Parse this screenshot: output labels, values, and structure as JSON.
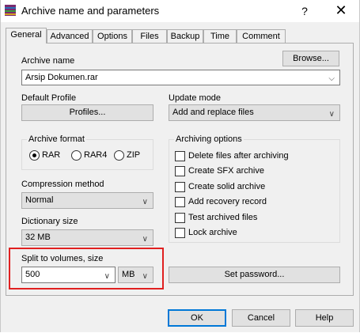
{
  "window": {
    "title": "Archive name and parameters",
    "help_glyph": "?",
    "close_glyph": "✕"
  },
  "tabs": [
    "General",
    "Advanced",
    "Options",
    "Files",
    "Backup",
    "Time",
    "Comment"
  ],
  "archive_name": {
    "label": "Archive name",
    "value": "Arsip Dokumen.rar",
    "browse_label": "Browse..."
  },
  "default_profile": {
    "label": "Default Profile",
    "button_label": "Profiles..."
  },
  "update_mode": {
    "label": "Update mode",
    "value": "Add and replace files"
  },
  "archive_format": {
    "label": "Archive format",
    "options": [
      "RAR",
      "RAR4",
      "ZIP"
    ],
    "selected": "RAR"
  },
  "compression_method": {
    "label": "Compression method",
    "value": "Normal"
  },
  "dictionary_size": {
    "label": "Dictionary size",
    "value": "32 MB"
  },
  "split_volumes": {
    "label": "Split to volumes, size",
    "value": "500",
    "unit": "MB"
  },
  "archiving_options": {
    "label": "Archiving options",
    "items": [
      "Delete files after archiving",
      "Create SFX archive",
      "Create solid archive",
      "Add recovery record",
      "Test archived files",
      "Lock archive"
    ]
  },
  "set_password_label": "Set password...",
  "footer": {
    "ok": "OK",
    "cancel": "Cancel",
    "help": "Help"
  },
  "colors": {
    "highlight": "#e02020",
    "default_button_border": "#0078d7"
  }
}
